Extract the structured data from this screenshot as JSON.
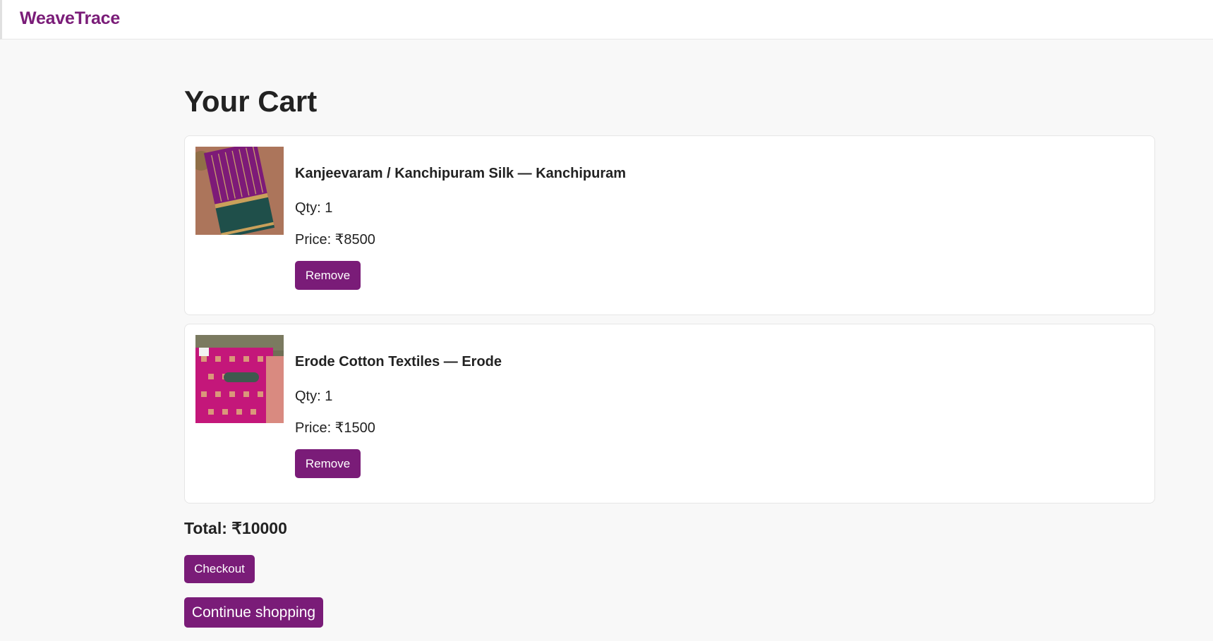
{
  "header": {
    "brand": "WeaveTrace"
  },
  "cart": {
    "title": "Your Cart",
    "items": [
      {
        "name": "Kanjeevaram / Kanchipuram Silk — Kanchipuram",
        "qty": "Qty: 1",
        "price": "Price: ₹8500",
        "remove_label": "Remove",
        "image_icon": "purple-silk-saree-image"
      },
      {
        "name": "Erode Cotton Textiles — Erode",
        "qty": "Qty: 1",
        "price": "Price: ₹1500",
        "remove_label": "Remove",
        "image_icon": "pink-cotton-saree-image"
      }
    ],
    "total": "Total: ₹10000",
    "checkout_label": "Checkout",
    "continue_label": "Continue shopping"
  },
  "colors": {
    "accent": "#7a1c78",
    "background": "#f8f8f8",
    "card": "#ffffff"
  }
}
